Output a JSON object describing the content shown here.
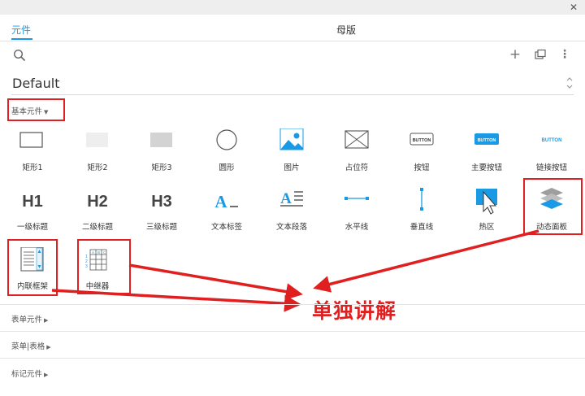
{
  "tabs": {
    "active": "元件",
    "master": "母版"
  },
  "toolbar": {
    "search_icon": "search-icon",
    "add": "+",
    "more": "⋮"
  },
  "library_select": {
    "value": "Default"
  },
  "sections": {
    "basic": "基本元件",
    "form": "表单元件",
    "menu_table": "菜单|表格",
    "markup": "标记元件"
  },
  "widgets": {
    "rect1": "矩形1",
    "rect2": "矩形2",
    "rect3": "矩形3",
    "ellipse": "圆形",
    "image": "图片",
    "placeholder": "占位符",
    "button": "按钮",
    "primary_button": "主要按钮",
    "link_button": "链接按钮",
    "h1": "一级标题",
    "h2": "二级标题",
    "h3": "三级标题",
    "text_label": "文本标签",
    "text_paragraph": "文本段落",
    "hline": "水平线",
    "vline": "垂直线",
    "hotspot": "热区",
    "dynamic_panel": "动态面板",
    "inline_frame": "内联框架",
    "repeater": "中继器"
  },
  "icon_text": {
    "h1": "H1",
    "h2": "H2",
    "h3": "H3",
    "btn": "BUTTON",
    "btn_primary": "BUTTON",
    "btn_link": "BUTTON",
    "text_a": "A"
  },
  "annotation": {
    "text": "单独讲解"
  },
  "colors": {
    "accent": "#1a9ae5",
    "annotation_red": "#e02020"
  }
}
